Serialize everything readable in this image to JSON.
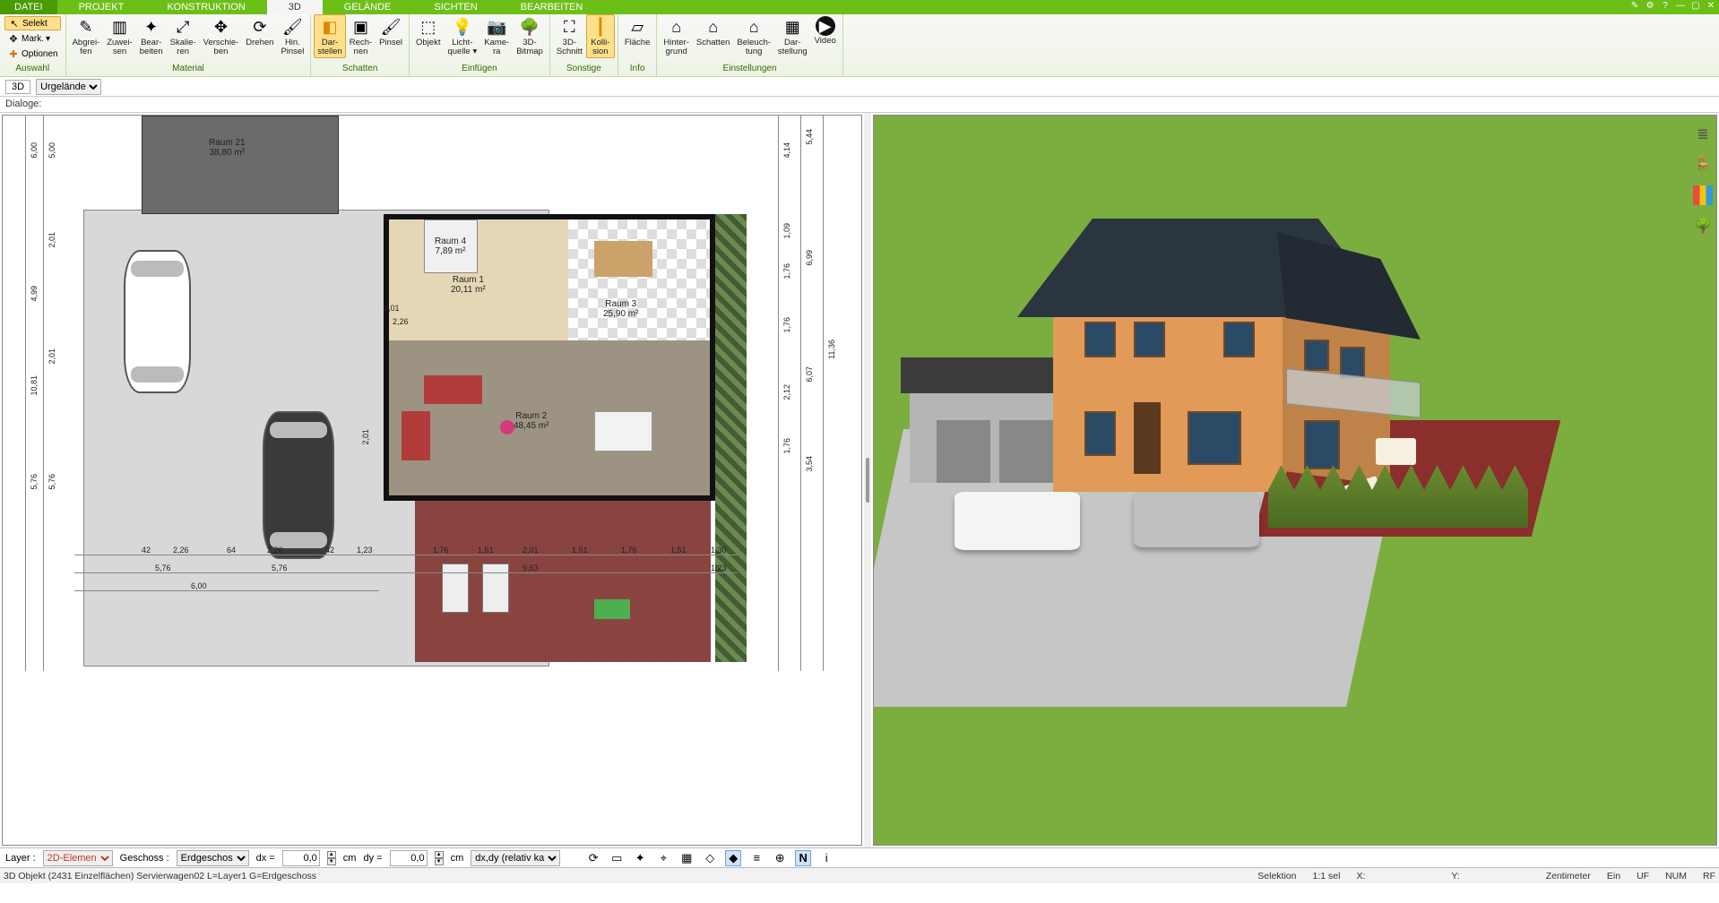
{
  "tabs": {
    "file": "DATEI",
    "list": [
      "PROJEKT",
      "KONSTRUKTION",
      "3D",
      "GELÄNDE",
      "SICHTEN",
      "BEARBEITEN"
    ],
    "active": 2
  },
  "ribbon": {
    "groups": {
      "auswahl": {
        "label": "Auswahl",
        "selekt": "Selekt",
        "mark": "Mark.",
        "optionen": "Optionen"
      },
      "material": {
        "label": "Material",
        "abgreifen": "Abgrei-\nfen",
        "zuweisen": "Zuwei-\nsen",
        "bearbeiten": "Bear-\nbeiten",
        "skalieren": "Skalie-\nren",
        "verschieben": "Verschie-\nben",
        "drehen": "Drehen",
        "hinpinsel": "Hin.\nPinsel"
      },
      "schatten": {
        "label": "Schatten",
        "darstellen": "Dar-\nstellen",
        "rechnen": "Rech-\nnen",
        "pinsel": "Pinsel"
      },
      "einfuegen": {
        "label": "Einfügen",
        "objekt": "Objekt",
        "licht": "Licht-\nquelle ▾",
        "kamera": "Kame-\nra",
        "bitmap": "3D-\nBitmap"
      },
      "sonstige": {
        "label": "Sonstige",
        "schnitt": "3D-\nSchnitt",
        "kollision": "Kolli-\nsion"
      },
      "info": {
        "label": "Info",
        "flaeche": "Fläche"
      },
      "einstell": {
        "label": "Einstellungen",
        "hintergrund": "Hinter-\ngrund",
        "schatten": "Schatten",
        "beleuchtung": "Beleuch-\ntung",
        "darstellung": "Dar-\nstellung",
        "video": "Video"
      }
    }
  },
  "subbar": {
    "mode": "3D",
    "terrain": "Urgelände"
  },
  "dialogbar": {
    "label": "Dialoge:"
  },
  "plan": {
    "rooms": {
      "r21": {
        "name": "Raum 21",
        "area": "38,80 m²"
      },
      "r4": {
        "name": "Raum 4",
        "area": "7,89 m²"
      },
      "r1": {
        "name": "Raum 1",
        "area": "20,11 m²"
      },
      "r3": {
        "name": "Raum 3",
        "area": "25,90 m²"
      },
      "r2": {
        "name": "Raum 2",
        "area": "48,45 m²"
      }
    },
    "dims": {
      "left_outer": [
        "6,00",
        "4,99",
        "10,81",
        "5,76",
        "5,76"
      ],
      "left_inner": [
        "5,00",
        "2,01",
        "2,01"
      ],
      "right_outer": [
        "4,14",
        "1,09",
        "1,76",
        "1,76",
        "2,12",
        "1,76"
      ],
      "right_mid": [
        "6,99",
        "11,36",
        "3,54",
        "5,44",
        "6,07"
      ],
      "bottom": [
        "42",
        "2,26",
        "64",
        "2,26",
        "42",
        "1,23",
        "1,76",
        "1,51",
        "2,01",
        "1,51",
        "1,76",
        "1,51",
        "1,30"
      ],
      "bottom2": [
        "5,76",
        "5,76",
        "9,63",
        "1,23"
      ],
      "bottom3": [
        "6,00"
      ],
      "small": [
        "2,01",
        "2,01",
        "2,26"
      ]
    }
  },
  "bottbar": {
    "layer_label": "Layer :",
    "layer_value": "2D-Elemen",
    "floor_label": "Geschoss :",
    "floor_value": "Erdgeschos",
    "dx_label": "dx =",
    "dx_value": "0,0",
    "dy_label": "dy =",
    "dy_value": "0,0",
    "unit": "cm",
    "mode": "dx,dy (relativ ka"
  },
  "status": {
    "left": "3D Objekt (2431 Einzelflächen) Servierwagen02 L=Layer1 G=Erdgeschoss",
    "sel": "Selektion",
    "scale": "1:1 sel",
    "x": "X:",
    "y": "Y:",
    "unit": "Zentimeter",
    "snap": "Ein",
    "uf": "UF",
    "num": "NUM",
    "rf": "RF"
  },
  "icons": {
    "pencil": "✎",
    "gear": "⚙",
    "help": "?",
    "min": "—",
    "max": "▢",
    "close": "✕",
    "layers": "≣",
    "chair": "🪑",
    "palette": "▦",
    "tree": "🌳"
  }
}
